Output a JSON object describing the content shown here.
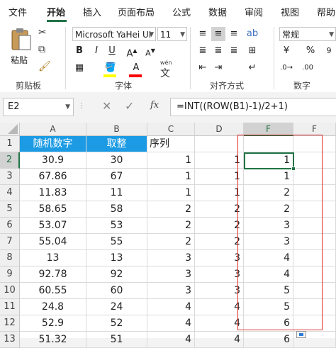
{
  "ribbon_tabs": [
    "文件",
    "开始",
    "插入",
    "页面布局",
    "公式",
    "数据",
    "审阅",
    "视图",
    "帮助"
  ],
  "clipboard": {
    "paste_label": "粘贴",
    "group_label": "剪贴板"
  },
  "font": {
    "name": "Microsoft YaHei UI",
    "size": "11",
    "bold": "B",
    "italic": "I",
    "underline": "U",
    "group_label": "字体",
    "phonetic": "wén",
    "font_color": "#ff0000",
    "fill_color": "#ffff00"
  },
  "alignment": {
    "group_label": "对齐方式"
  },
  "number": {
    "format": "常规",
    "group_label": "数字"
  },
  "formula_bar": {
    "name_box": "E2",
    "fx": "fx",
    "formula": "=INT((ROW(B1)-1)/2+1)"
  },
  "sheet": {
    "columns": [
      "A",
      "B",
      "C",
      "D",
      "F",
      "F"
    ],
    "row_numbers": [
      "1",
      "2",
      "3",
      "4",
      "5",
      "6",
      "7",
      "8",
      "9",
      "10",
      "11",
      "12",
      "13"
    ],
    "header_row": {
      "a": "随机数字",
      "b": "取整",
      "c": "序列"
    },
    "rows": [
      {
        "a": "30.9",
        "b": "30",
        "c": "1",
        "d": "1",
        "e": "1"
      },
      {
        "a": "67.86",
        "b": "67",
        "c": "1",
        "d": "1",
        "e": "1"
      },
      {
        "a": "11.83",
        "b": "11",
        "c": "1",
        "d": "1",
        "e": "2"
      },
      {
        "a": "58.65",
        "b": "58",
        "c": "2",
        "d": "2",
        "e": "2"
      },
      {
        "a": "53.07",
        "b": "53",
        "c": "2",
        "d": "2",
        "e": "3"
      },
      {
        "a": "55.04",
        "b": "55",
        "c": "2",
        "d": "2",
        "e": "3"
      },
      {
        "a": "13",
        "b": "13",
        "c": "3",
        "d": "3",
        "e": "4"
      },
      {
        "a": "92.78",
        "b": "92",
        "c": "3",
        "d": "3",
        "e": "4"
      },
      {
        "a": "60.55",
        "b": "60",
        "c": "3",
        "d": "3",
        "e": "5"
      },
      {
        "a": "24.8",
        "b": "24",
        "c": "4",
        "d": "4",
        "e": "5"
      },
      {
        "a": "52.9",
        "b": "52",
        "c": "4",
        "d": "4",
        "e": "6"
      },
      {
        "a": "51.32",
        "b": "51",
        "c": "4",
        "d": "4",
        "e": "6"
      }
    ]
  },
  "colors": {
    "accent": "#217346",
    "header_fill": "#1c9be4",
    "annotation": "#e03030"
  }
}
